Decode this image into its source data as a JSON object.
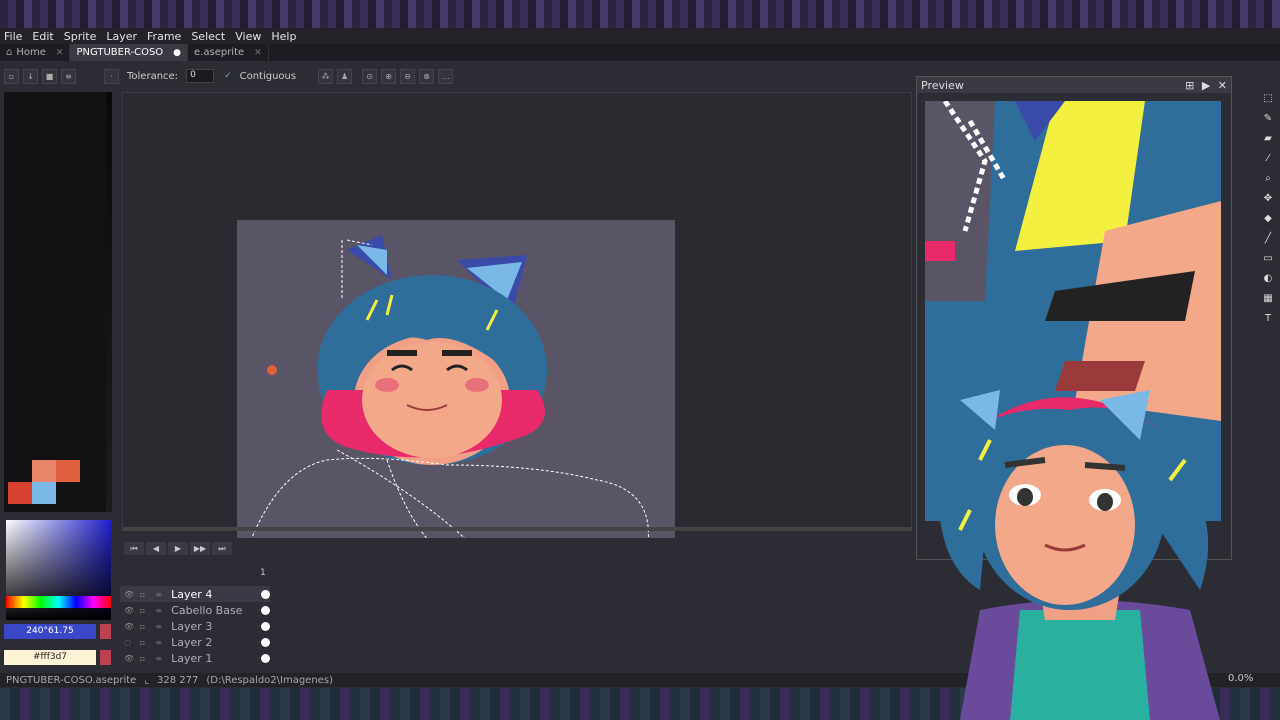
{
  "menu": [
    "File",
    "Edit",
    "Sprite",
    "Layer",
    "Frame",
    "Select",
    "View",
    "Help"
  ],
  "tabs": [
    {
      "label": "Home",
      "active": false
    },
    {
      "label": "PNGTUBER-COSO",
      "active": true
    },
    {
      "label": "e.aseprite",
      "active": false
    }
  ],
  "toolbar": {
    "tolerance_label": "Tolerance:",
    "tolerance_value": "0",
    "contiguous_label": "Contiguous"
  },
  "colors": {
    "hsv_text": "240°61.75",
    "hex_text": "#fff3d7",
    "palette": [
      "#e8846a",
      "#e06040",
      "#d84030",
      "#7ab8e8"
    ]
  },
  "timeline": {
    "frame_number": "1",
    "layers": [
      {
        "name": "Layer 4",
        "active": true,
        "visible": true
      },
      {
        "name": "Cabello Base",
        "active": false,
        "visible": true
      },
      {
        "name": "Layer 3",
        "active": false,
        "visible": true
      },
      {
        "name": "Layer 2",
        "active": false,
        "visible": false
      },
      {
        "name": "Layer 1",
        "active": false,
        "visible": true
      }
    ]
  },
  "status": {
    "filename": "PNGTUBER-COSO.aseprite",
    "coords": "328 277",
    "path": "(D:\\Respaldo2\\Imagenes)",
    "zoom": "0.0%"
  },
  "preview": {
    "title": "Preview"
  }
}
